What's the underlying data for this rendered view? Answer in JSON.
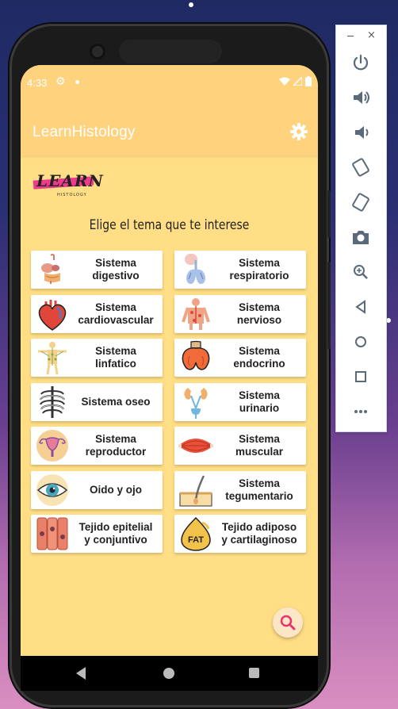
{
  "status_bar": {
    "time": "4:33"
  },
  "app_bar": {
    "title": "LearnHistology",
    "settings_icon": "gear-icon"
  },
  "logo": {
    "text": "LEARN",
    "subtext": "HISTOLOGY"
  },
  "subtitle": "Elige el tema que te interese",
  "topics": [
    {
      "label": "Sistema\ndigestivo",
      "icon": "digestive-system-icon"
    },
    {
      "label": "Sistema\nrespiratorio",
      "icon": "lungs-icon"
    },
    {
      "label": "Sistema\ncardiovascular",
      "icon": "heart-icon"
    },
    {
      "label": "Sistema\nnervioso",
      "icon": "nervous-system-icon"
    },
    {
      "label": "Sistema\nlinfatico",
      "icon": "lymphatic-system-icon"
    },
    {
      "label": "Sistema\nendocrino",
      "icon": "thyroid-icon"
    },
    {
      "label": "Sistema oseo",
      "icon": "ribcage-icon"
    },
    {
      "label": "Sistema\nurinario",
      "icon": "kidneys-icon"
    },
    {
      "label": "Sistema\nreproductor",
      "icon": "uterus-icon"
    },
    {
      "label": "Sistema\nmuscular",
      "icon": "muscle-icon"
    },
    {
      "label": "Oido y ojo",
      "icon": "eye-icon"
    },
    {
      "label": "Sistema\ntegumentario",
      "icon": "skin-icon"
    },
    {
      "label": "Tejido epitelial\ny conjuntivo",
      "icon": "tissue-cells-icon"
    },
    {
      "label": "Tejido adiposo\ny cartilaginoso",
      "icon": "fat-icon"
    }
  ],
  "fab": {
    "icon": "search-icon"
  },
  "colors": {
    "screen_bg": "#ffde85",
    "app_bar": "#ffd27e",
    "fab_icon": "#e8336d"
  },
  "emulator_panel": {
    "buttons": [
      "power-icon",
      "volume-up-icon",
      "volume-down-icon",
      "rotate-left-icon",
      "rotate-right-icon",
      "camera-icon",
      "zoom-icon",
      "back-icon",
      "home-icon",
      "overview-icon",
      "more-icon"
    ]
  }
}
